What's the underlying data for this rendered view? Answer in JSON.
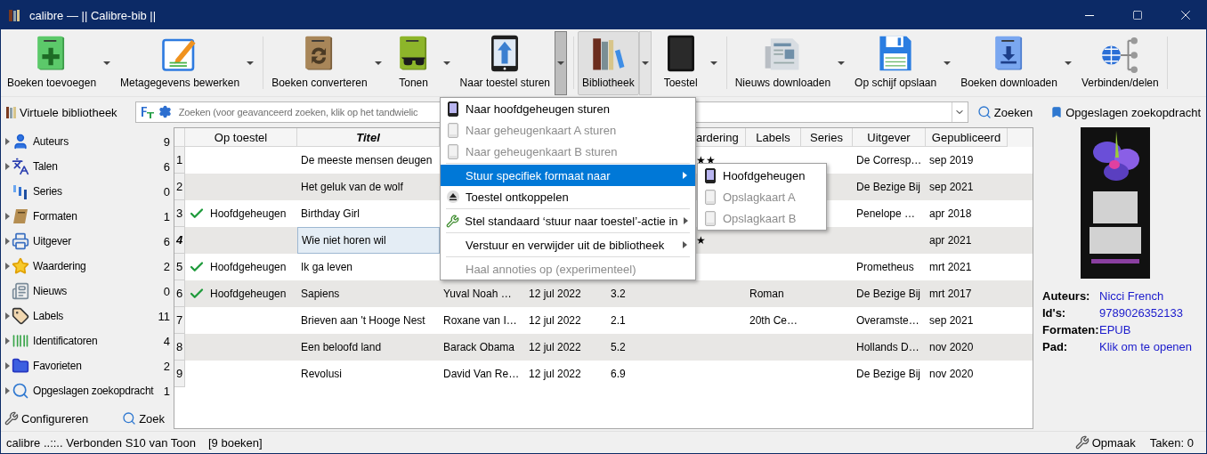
{
  "window": {
    "title": "calibre — || Calibre-bib ||"
  },
  "toolbar": {
    "tools": [
      {
        "label": "Boeken toevoegen",
        "kind": "caret",
        "active": false,
        "open": false
      },
      {
        "label": "Metagegevens bewerken",
        "kind": "caret",
        "active": false,
        "open": false
      },
      {
        "label": "Boeken converteren",
        "kind": "caret",
        "active": false,
        "open": false
      },
      {
        "label": "Tonen",
        "kind": "caret",
        "active": false,
        "open": false
      },
      {
        "label": "Naar toestel sturen",
        "kind": "split",
        "active": false,
        "open": true
      },
      {
        "label": "Bibliotheek",
        "kind": "split",
        "active": true,
        "open": false
      },
      {
        "label": "Toestel",
        "kind": "caret",
        "active": false,
        "open": false
      },
      {
        "label": "Nieuws downloaden",
        "kind": "caret",
        "active": false,
        "open": false
      },
      {
        "label": "Op schijf opslaan",
        "kind": "caret",
        "active": false,
        "open": false
      },
      {
        "label": "Boeken downloaden",
        "kind": "caret",
        "active": false,
        "open": false
      },
      {
        "label": "Verbinden/delen",
        "kind": "plain",
        "active": false,
        "open": false
      }
    ]
  },
  "search_bar": {
    "virtual_library": "Virtuele bibliotheek",
    "placeholder": "Zoeken (voor geavanceerd zoeken, klik op het tandwielic",
    "search_button": "Zoeken",
    "saved_searches": "Opgeslagen zoekopdracht"
  },
  "sidebar": {
    "items": [
      {
        "label": "Auteurs",
        "count": "9",
        "expandable": true
      },
      {
        "label": "Talen",
        "count": "6",
        "expandable": true
      },
      {
        "label": "Series",
        "count": "0",
        "expandable": false
      },
      {
        "label": "Formaten",
        "count": "1",
        "expandable": true
      },
      {
        "label": "Uitgever",
        "count": "6",
        "expandable": true
      },
      {
        "label": "Waardering",
        "count": "2",
        "expandable": true
      },
      {
        "label": "Nieuws",
        "count": "0",
        "expandable": false
      },
      {
        "label": "Labels",
        "count": "11",
        "expandable": true
      },
      {
        "label": "Identificatoren",
        "count": "4",
        "expandable": true
      },
      {
        "label": "Favorieten",
        "count": "2",
        "expandable": true
      },
      {
        "label": "Opgeslagen zoekopdracht",
        "count": "1",
        "expandable": true
      }
    ],
    "configure": "Configureren",
    "find": "Zoek"
  },
  "table": {
    "columns": [
      "Op toestel",
      "Titel",
      null,
      null,
      null,
      "ardering",
      "Labels",
      "Series",
      "Uitgever",
      "Gepubliceerd"
    ],
    "rows": [
      {
        "number": "1",
        "selected": false,
        "checked": false,
        "cells": [
          null,
          "De meeste mensen deugen",
          null,
          null,
          null,
          "★★",
          null,
          null,
          "De Corresp…",
          "sep 2019"
        ]
      },
      {
        "number": "2",
        "selected": false,
        "checked": false,
        "cells": [
          null,
          "Het geluk van de wolf",
          null,
          null,
          null,
          null,
          null,
          null,
          "De Bezige Bij",
          "sep 2021"
        ]
      },
      {
        "number": "3",
        "selected": false,
        "checked": true,
        "cells": [
          "Hoofdgeheugen",
          "Birthday Girl",
          null,
          null,
          null,
          null,
          null,
          null,
          "Penelope …",
          "apr 2018"
        ]
      },
      {
        "number": "4",
        "selected": true,
        "checked": false,
        "cells": [
          null,
          "Wie niet horen wil",
          null,
          null,
          null,
          "★",
          null,
          null,
          null,
          "apr 2021"
        ]
      },
      {
        "number": "5",
        "selected": false,
        "checked": true,
        "cells": [
          "Hoofdgeheugen",
          "Ik ga leven",
          null,
          null,
          null,
          null,
          null,
          null,
          "Prometheus",
          "mrt 2021"
        ]
      },
      {
        "number": "6",
        "selected": false,
        "checked": true,
        "cells": [
          "Hoofdgeheugen",
          "Sapiens",
          "Yuval Noah …",
          "12 jul 2022",
          "3.2",
          null,
          "Roman",
          null,
          "De Bezige Bij",
          "mrt 2017"
        ]
      },
      {
        "number": "7",
        "selected": false,
        "checked": false,
        "cells": [
          null,
          "Brieven aan 't Hooge Nest",
          "Roxane van I…",
          "12 jul 2022",
          "2.1",
          null,
          "20th Ce…",
          null,
          "Overamste…",
          "sep 2021"
        ]
      },
      {
        "number": "8",
        "selected": false,
        "checked": false,
        "cells": [
          null,
          "Een beloofd land",
          "Barack Obama",
          "12 jul 2022",
          "5.2",
          null,
          null,
          null,
          "Hollands D…",
          "nov 2020"
        ]
      },
      {
        "number": "9",
        "selected": false,
        "checked": false,
        "cells": [
          null,
          "Revolusi",
          "David Van Re…",
          "12 jul 2022",
          "6.9",
          null,
          null,
          null,
          "De Bezige Bij",
          "nov 2020"
        ]
      }
    ]
  },
  "book_details": {
    "fields": [
      {
        "label": "Auteurs:",
        "value": "Nicci French"
      },
      {
        "label": "Id's:",
        "value": "9789026352133"
      },
      {
        "label": "Formaten:",
        "value": "EPUB"
      },
      {
        "label": "Pad:",
        "value": "Klik om te openen"
      }
    ]
  },
  "device_menu": {
    "items": [
      {
        "kind": "action",
        "label": "Naar hoofdgeheugen sturen",
        "disabled": false,
        "selected": false,
        "has_submenu": false
      },
      {
        "kind": "action",
        "label": "Naar geheugenkaart A sturen",
        "disabled": true,
        "selected": false,
        "has_submenu": false
      },
      {
        "kind": "action",
        "label": "Naar geheugenkaart B sturen",
        "disabled": true,
        "selected": false,
        "has_submenu": false
      },
      {
        "kind": "separator"
      },
      {
        "kind": "action",
        "label": "Stuur specifiek formaat naar",
        "disabled": false,
        "selected": true,
        "has_submenu": true
      },
      {
        "kind": "action",
        "label": "Toestel ontkoppelen",
        "disabled": false,
        "selected": false,
        "has_submenu": false
      },
      {
        "kind": "separator"
      },
      {
        "kind": "action",
        "label": "Stel standaard ‘stuur naar toestel’-actie in",
        "disabled": false,
        "selected": false,
        "has_submenu": true
      },
      {
        "kind": "separator"
      },
      {
        "kind": "action",
        "label": "Verstuur en verwijder uit de bibliotheek",
        "disabled": false,
        "selected": false,
        "has_submenu": true
      },
      {
        "kind": "separator"
      },
      {
        "kind": "action",
        "label": "Haal annoties op (experimenteel)",
        "disabled": true,
        "selected": false,
        "has_submenu": false
      }
    ],
    "submenu": {
      "items": [
        {
          "label": "Hoofdgeheugen",
          "disabled": false
        },
        {
          "label": "Opslagkaart A",
          "disabled": true
        },
        {
          "label": "Opslagkaart B",
          "disabled": true
        }
      ]
    }
  },
  "status_bar": {
    "connection": "calibre ..::.. Verbonden S10 van Toon",
    "count": "[9 boeken]",
    "layout_button": "Opmaak",
    "jobs": "Taken: 0"
  }
}
